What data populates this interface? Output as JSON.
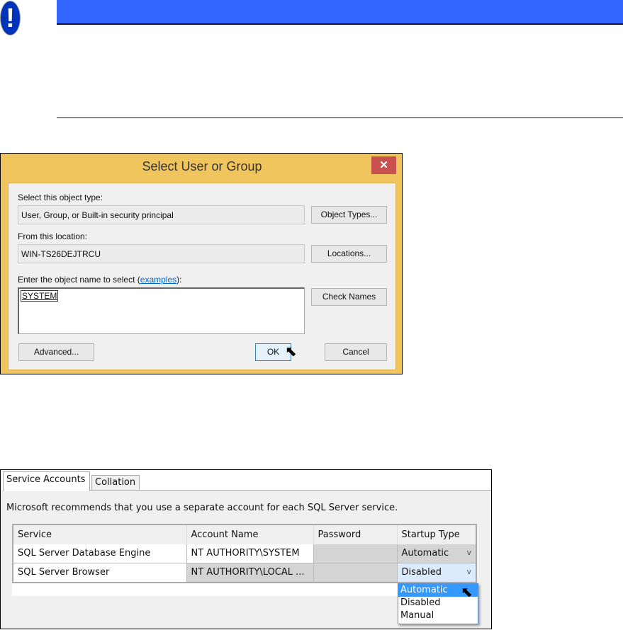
{
  "warning": {
    "icon": "exclamation-icon",
    "glyph": "!"
  },
  "dialog": {
    "title": "Select User or Group",
    "close": "✕",
    "object_type_label": "Select this object type:",
    "object_type_value": "User, Group, or Built-in security principal",
    "object_types_button": "Object Types...",
    "location_label": "From this location:",
    "location_value": "WIN-TS26DEJTRCU",
    "locations_button": "Locations...",
    "enter_label_prefix": "Enter the object name to select (",
    "enter_label_link": "examples",
    "enter_label_suffix": "):",
    "object_name": "SYSTEM",
    "check_names_button": "Check Names",
    "advanced_button": "Advanced...",
    "ok_button": "OK",
    "cancel_button": "Cancel"
  },
  "sql": {
    "tabs": [
      "Service Accounts",
      "Collation"
    ],
    "recommendation": "Microsoft recommends that you use a separate account for each SQL Server service.",
    "columns": [
      "Service",
      "Account Name",
      "Password",
      "Startup Type"
    ],
    "rows": [
      {
        "service": "SQL Server Database Engine",
        "account": "NT AUTHORITY\\SYSTEM",
        "password": "",
        "startup": "Automatic"
      },
      {
        "service": "SQL Server Browser",
        "account": "NT AUTHORITY\\LOCAL ...",
        "password": "",
        "startup": "Disabled"
      }
    ],
    "dropdown_options": [
      "Automatic",
      "Disabled",
      "Manual"
    ],
    "chevron": "v"
  }
}
